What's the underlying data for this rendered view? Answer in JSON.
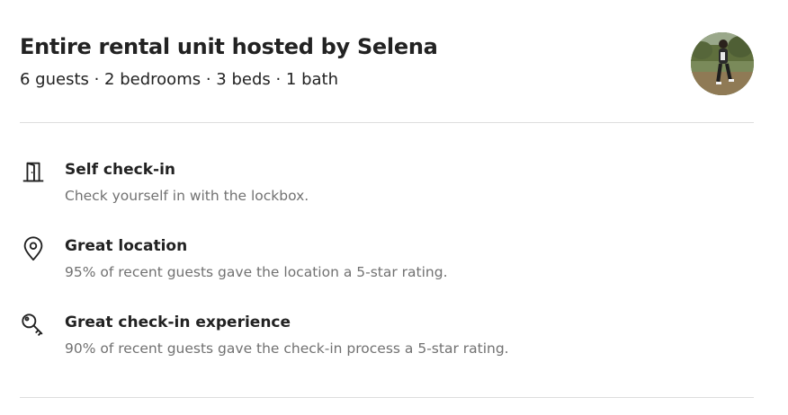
{
  "overview": {
    "title": "Entire rental unit hosted by Selena",
    "details": "6 guests · 2 bedrooms · 3 beds · 1 bath",
    "host_avatar": "host-photo"
  },
  "highlights": [
    {
      "icon": "door-icon",
      "title": "Self check-in",
      "description": "Check yourself in with the lockbox."
    },
    {
      "icon": "location-pin-icon",
      "title": "Great location",
      "description": "95% of recent guests gave the location a 5-star rating."
    },
    {
      "icon": "key-icon",
      "title": "Great check-in experience",
      "description": "90% of recent guests gave the check-in process a 5-star rating."
    }
  ],
  "colors": {
    "text_primary": "#222222",
    "text_secondary": "#717171",
    "divider": "#dddddd"
  }
}
